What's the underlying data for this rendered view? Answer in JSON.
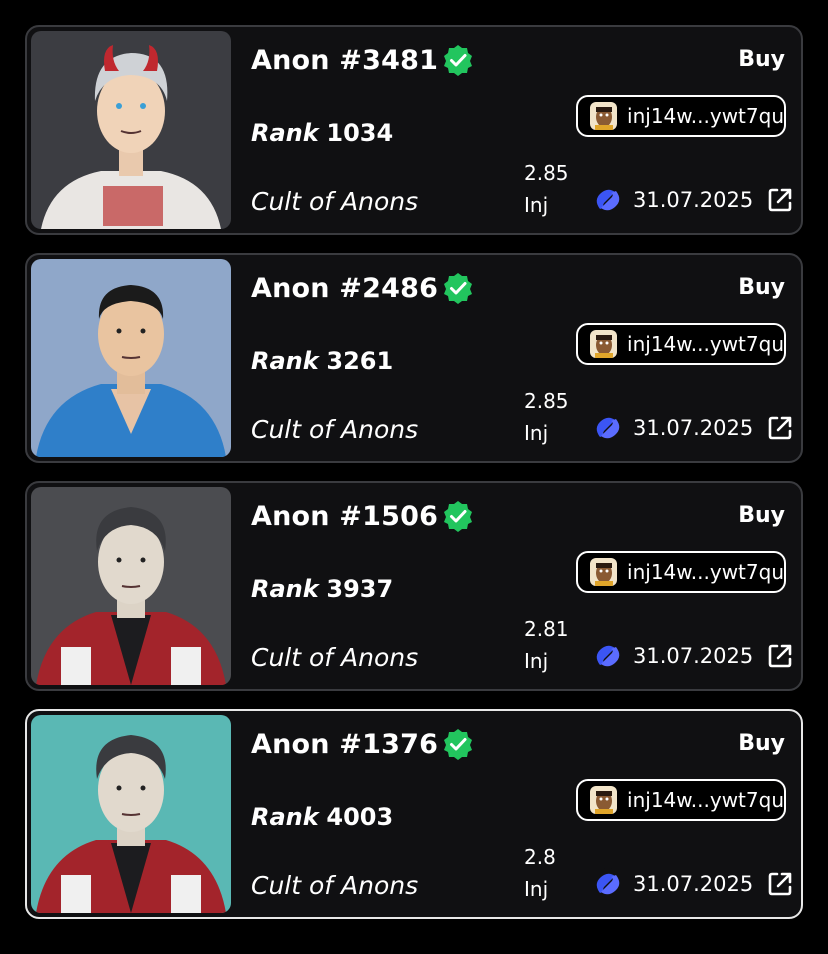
{
  "icons": {
    "verified": "verified-badge-icon",
    "chain": "injective-logo-icon",
    "external": "external-link-icon"
  },
  "colors": {
    "verified": "#22c55e",
    "injective": "#3b55f5",
    "card_bg": "#101012"
  },
  "listings": [
    {
      "name": "Anon #3481",
      "buy_label": "Buy",
      "owner": "inj14w...ywt7qu",
      "rank_label": "Rank",
      "rank": "1034",
      "collection": "Cult of Anons",
      "price": "2.85",
      "currency": "Inj",
      "date": "31.07.2025"
    },
    {
      "name": "Anon #2486",
      "buy_label": "Buy",
      "owner": "inj14w...ywt7qu",
      "rank_label": "Rank",
      "rank": "3261",
      "collection": "Cult of Anons",
      "price": "2.85",
      "currency": "Inj",
      "date": "31.07.2025"
    },
    {
      "name": "Anon #1506",
      "buy_label": "Buy",
      "owner": "inj14w...ywt7qu",
      "rank_label": "Rank",
      "rank": "3937",
      "collection": "Cult of Anons",
      "price": "2.81",
      "currency": "Inj",
      "date": "31.07.2025"
    },
    {
      "name": "Anon #1376",
      "buy_label": "Buy",
      "owner": "inj14w...ywt7qu",
      "rank_label": "Rank",
      "rank": "4003",
      "collection": "Cult of Anons",
      "price": "2.8",
      "currency": "Inj",
      "date": "31.07.2025"
    }
  ]
}
